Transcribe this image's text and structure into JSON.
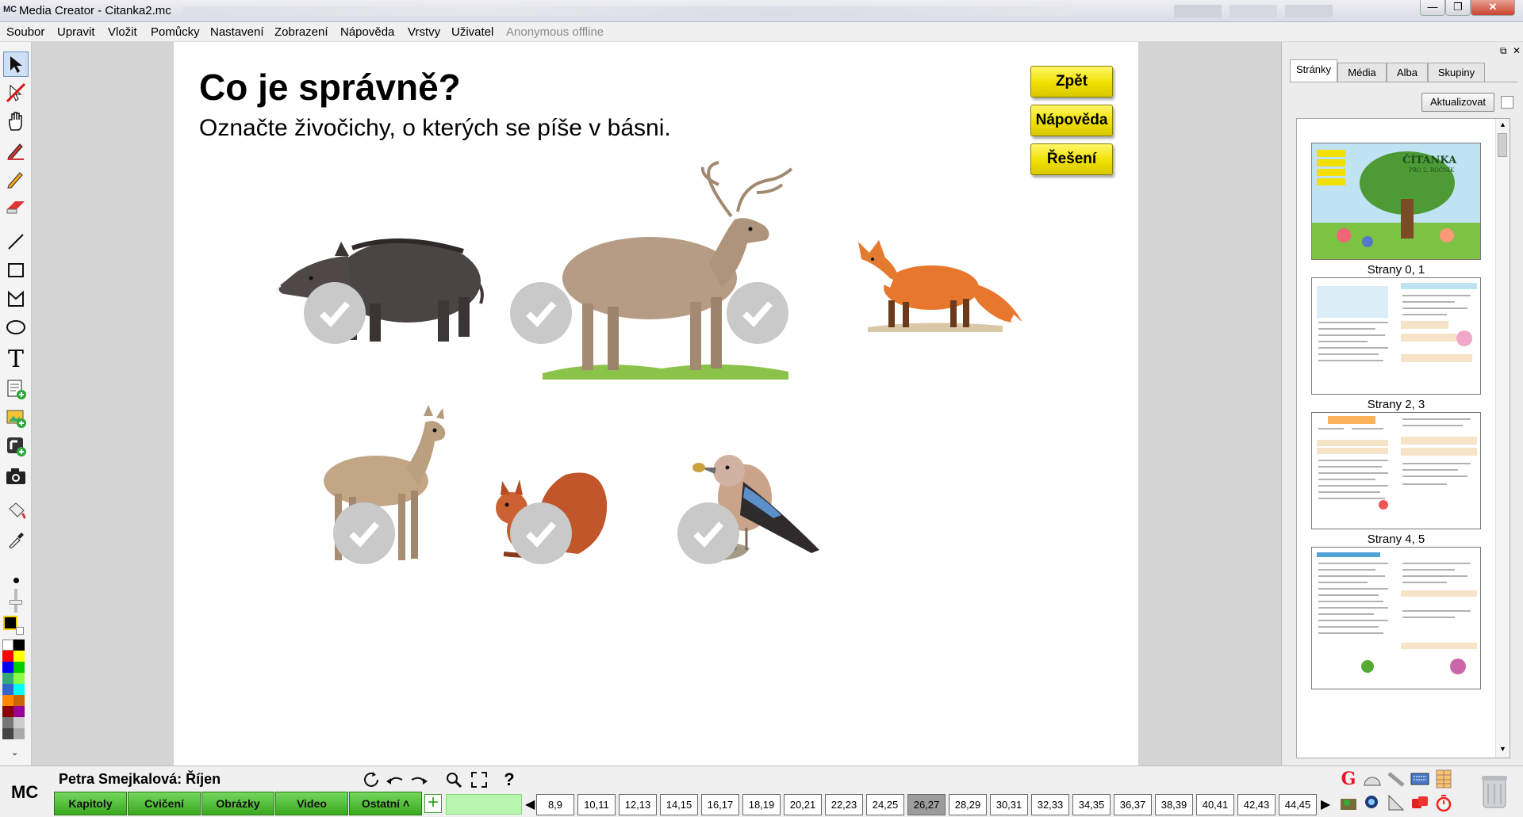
{
  "window": {
    "app_badge": "MC",
    "title": "Media Creator - Citanka2.mc",
    "min": "—",
    "max": "❐",
    "close": "✕"
  },
  "menu": [
    "Soubor",
    "Upravit",
    "Vložit",
    "Pomůcky",
    "Nastavení",
    "Zobrazení",
    "Nápověda",
    "Vrstvy",
    "Uživatel",
    "Anonymous offline"
  ],
  "slide": {
    "heading": "Co je správně?",
    "instruction": "Označte živočichy, o kterých se píše v básni.",
    "buttons": {
      "back": "Zpět",
      "help": "Nápověda",
      "solution": "Řešení"
    },
    "animals": [
      "wild-boar",
      "red-deer-stag",
      "fox",
      "roe-deer",
      "squirrel",
      "jay"
    ]
  },
  "right_panel": {
    "tabs": [
      "Stránky",
      "Média",
      "Alba",
      "Skupiny"
    ],
    "active_tab": "Stránky",
    "refresh": "Aktualizovat",
    "thumb_cover_title": "ČÍTANKA",
    "thumb_cover_subtitle": "PRO 2. ROČNÍK",
    "pages": [
      "Strany 0, 1",
      "Strany 2, 3",
      "Strany 4, 5"
    ]
  },
  "bottom": {
    "logo": "MC",
    "author": "Petra Smejkalová: Říjen",
    "help": "?",
    "tabs": [
      "Kapitoly",
      "Cvičení",
      "Obrázky",
      "Video",
      "Ostatní ˄"
    ],
    "plus": "+",
    "prev": "◀",
    "next": "▶",
    "pages": [
      "8,9",
      "10,11",
      "12,13",
      "14,15",
      "16,17",
      "18,19",
      "20,21",
      "22,23",
      "24,25",
      "26,27",
      "28,29",
      "30,31",
      "32,33",
      "34,35",
      "36,37",
      "38,39",
      "40,41",
      "42,43",
      "44,45"
    ],
    "current_page": "26,27"
  },
  "colors": {
    "accent_yellow": "#f1e000",
    "bottom_green": "#3aa81e",
    "field_green": "#b8f6b0"
  }
}
